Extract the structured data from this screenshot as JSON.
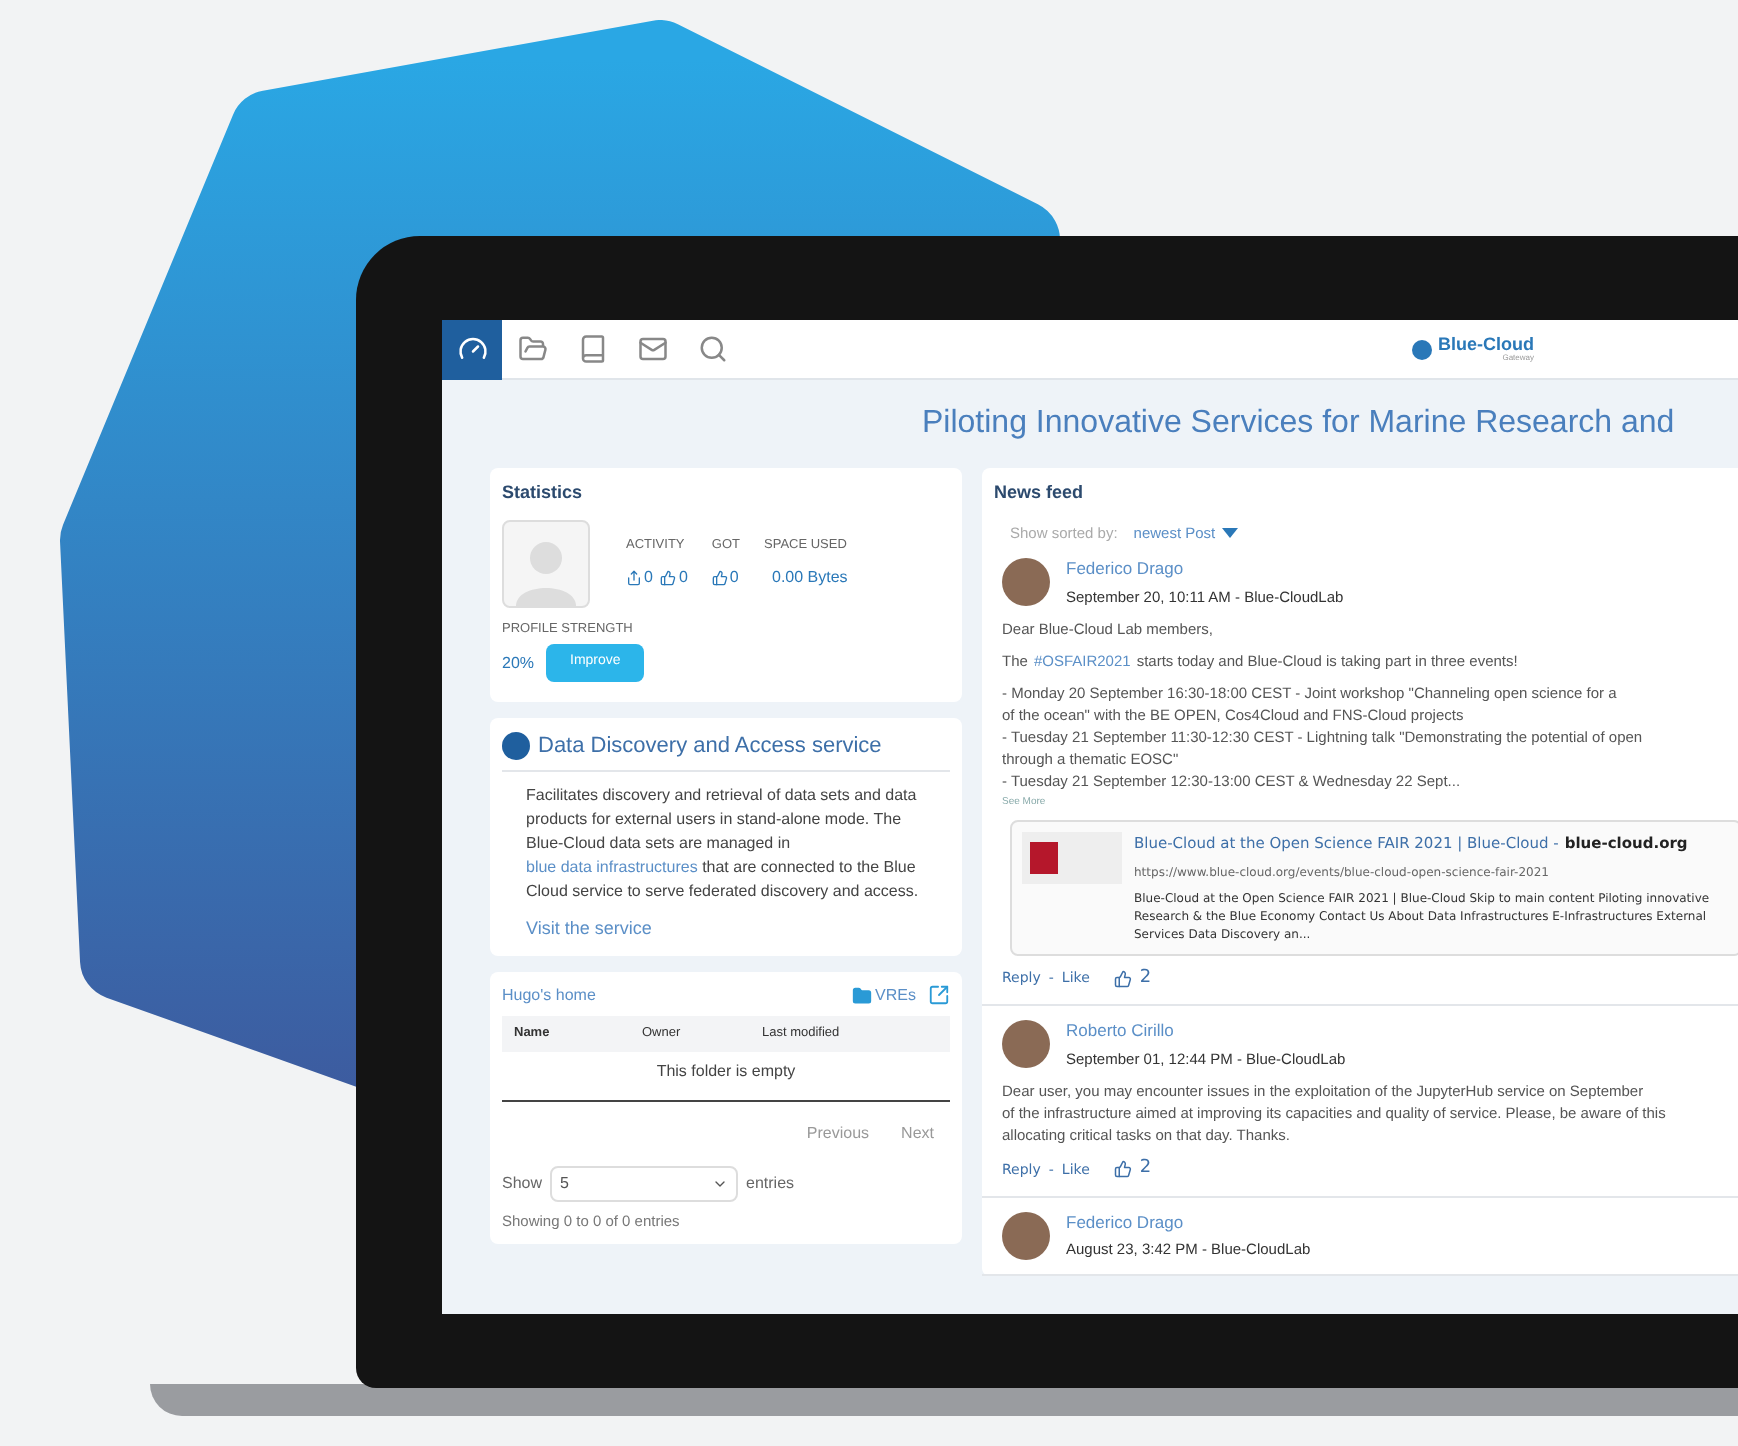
{
  "nav": {
    "icons": [
      {
        "kind": "dashboard",
        "selected": true
      },
      {
        "kind": "folder",
        "selected": false
      },
      {
        "kind": "book",
        "selected": false
      },
      {
        "kind": "mail",
        "selected": false
      },
      {
        "kind": "search",
        "selected": false
      }
    ],
    "logo": {
      "name": "Blue-Cloud",
      "subtitle": "Gateway"
    }
  },
  "page_title": "Piloting Innovative Services for Marine Research and",
  "statistics": {
    "title": "Statistics",
    "columns": [
      {
        "label": "ACTIVITY",
        "values": [
          {
            "kind": "share",
            "text": "0"
          },
          {
            "kind": "like",
            "text": "0"
          }
        ]
      },
      {
        "label": "GOT",
        "values": [
          {
            "kind": "like",
            "text": "0"
          }
        ]
      },
      {
        "label": "SPACE USED",
        "values": [
          {
            "kind": "plain",
            "text": "0.00 Bytes"
          }
        ]
      }
    ],
    "profile_label": "PROFILE STRENGTH",
    "profile_value": "20%",
    "improve_button": "Improve"
  },
  "service": {
    "title": "Data Discovery and Access service",
    "text_before": "Facilitates discovery and retrieval of data sets and data products for external users in stand-alone mode. The Blue-Cloud data sets are managed in",
    "link": "blue data infrastructures",
    "text_after": "that are connected to the Blue Cloud service to serve federated discovery and access.",
    "visit_link": "Visit the service"
  },
  "home": {
    "title": "Hugo's home",
    "vres": "VREs",
    "columns": [
      "Name",
      "Owner",
      "Last modified"
    ],
    "empty": "This folder is empty",
    "previous": "Previous",
    "next": "Next",
    "show_label": "Show",
    "page_size": "5",
    "entries_label": "entries",
    "info": "Showing 0 to 0 of 0 entries"
  },
  "feed": {
    "title": "News feed",
    "sort_label": "Show sorted by:",
    "sort_value": "newest Post",
    "posts": [
      {
        "author": "Federico Drago",
        "meta": "September 20, 10:11 AM - Blue-CloudLab",
        "blocks": [
          {
            "kind": "text",
            "lines": [
              "Dear Blue-Cloud Lab members,"
            ]
          },
          {
            "kind": "tagged",
            "before": "The",
            "tag": "#OSFAIR2021",
            "after": "starts today and Blue-Cloud is taking part in three events!"
          },
          {
            "kind": "text",
            "lines": [
              "- Monday 20 September 16:30-18:00 CEST - Joint workshop \"Channeling open science for a",
              "of the ocean\" with the BE OPEN, Cos4Cloud and FNS-Cloud projects",
              "- Tuesday 21 September 11:30-12:30 CEST - Lightning talk \"Demonstrating the potential of open",
              "through a thematic EOSC\"",
              "- Tuesday 21 September 12:30-13:00 CEST & Wednesday 22 Sept..."
            ]
          }
        ],
        "see_more": "See More",
        "link_card": {
          "title": "Blue-Cloud at the Open Science FAIR 2021 | Blue-Cloud -",
          "site": "blue-cloud.org",
          "url": "https://www.blue-cloud.org/events/blue-cloud-open-science-fair-2021",
          "lines": [
            "Blue-Cloud at the Open Science FAIR 2021 | Blue-Cloud Skip to main content Piloting innovative",
            "Research & the Blue Economy Contact Us About Data Infrastructures E-Infrastructures External",
            "Services Data Discovery an..."
          ]
        },
        "reply": "Reply",
        "separator": "-",
        "like": "Like",
        "likes": "2"
      },
      {
        "author": "Roberto Cirillo",
        "meta": "September 01, 12:44 PM - Blue-CloudLab",
        "blocks": [
          {
            "kind": "text",
            "lines": [
              "Dear user, you may encounter issues in the exploitation of the JupyterHub service on September",
              "of the infrastructure aimed at improving its capacities and quality of service. Please, be aware of this",
              "allocating critical tasks on that day. Thanks."
            ]
          }
        ],
        "reply": "Reply",
        "separator": "-",
        "like": "Like",
        "likes": "2"
      },
      {
        "author": "Federico Drago",
        "meta": "August 23, 3:42 PM - Blue-CloudLab"
      }
    ]
  }
}
